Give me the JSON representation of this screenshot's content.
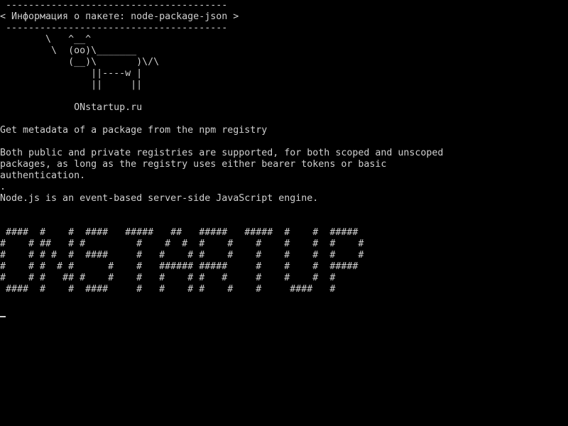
{
  "terminal": {
    "lines": [
      " ---------------------------------------",
      "< Информация о пакете: node-package-json >",
      " ---------------------------------------",
      "        \\   ^__^",
      "         \\  (oo)\\_______",
      "            (__)\\       )\\/\\",
      "                ||----w |",
      "                ||     ||",
      "",
      "             ONstartup.ru",
      "",
      "Get metadata of a package from the npm registry",
      "",
      "Both public and private registries are supported, for both scoped and unscoped",
      "packages, as long as the registry uses either bearer tokens or basic",
      "authentication.",
      ".",
      "Node.js is an event-based server-side JavaScript engine.",
      "",
      "",
      " ####  #    #  ####   #####   ##   #####   #####  #    #  #####",
      "#    # ##   # #         #    #  #  #    #    #    #    #  #    #",
      "#    # # #  #  ####     #   #    # #    #    #    #    #  #    #",
      "#    # #  # #      #    #   ###### #####     #    #    #  #####",
      "#    # #   ## #    #    #   #    # #   #     #    #    #  #",
      " ####  #    #  ####     #   #    # #    #    #     ####   #",
      "",
      ""
    ]
  }
}
